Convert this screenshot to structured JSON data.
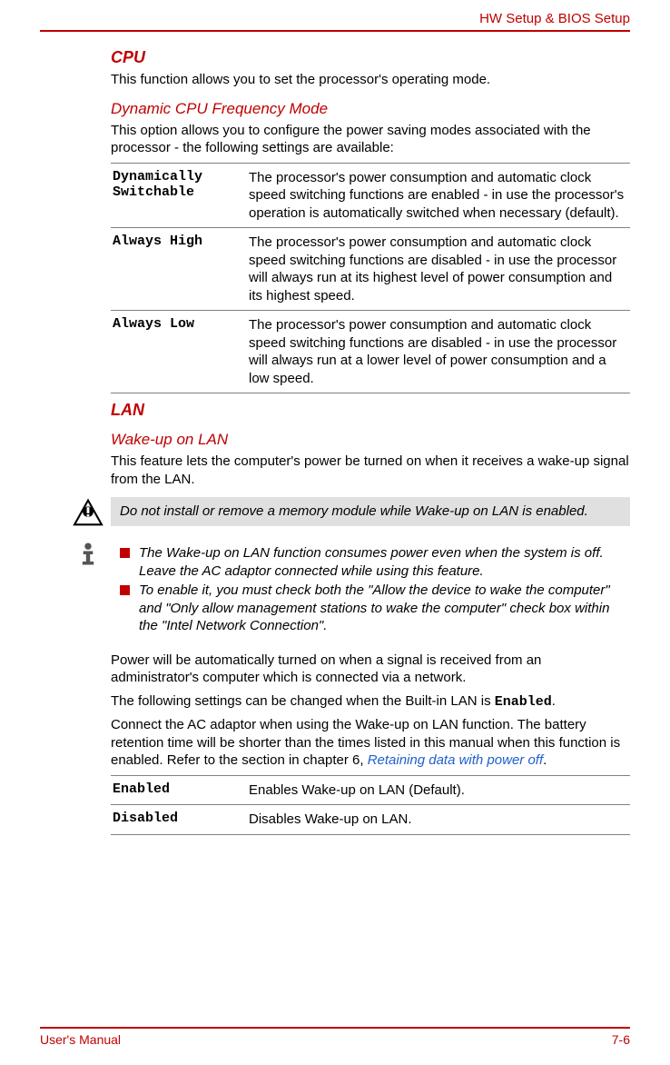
{
  "header": {
    "right": "HW Setup & BIOS Setup"
  },
  "cpu": {
    "heading": "CPU",
    "intro": "This function allows you to set the processor's operating mode.",
    "subheading": "Dynamic CPU Frequency Mode",
    "subintro": "This option allows you to configure the power saving modes associated with the processor - the following settings are available:",
    "rows": [
      {
        "term": "Dynamically Switchable",
        "desc": "The processor's power consumption and automatic clock speed switching functions are enabled - in use the processor's operation is automatically switched when necessary (default)."
      },
      {
        "term": "Always High",
        "desc": "The processor's power consumption and automatic clock speed switching functions are disabled - in use the processor will always run at its highest level of power consumption and its highest speed."
      },
      {
        "term": "Always Low",
        "desc": "The processor's power consumption and automatic clock speed switching functions are disabled - in use the processor will always run at a lower level of power consumption and a low speed."
      }
    ]
  },
  "lan": {
    "heading": "LAN",
    "subheading": "Wake-up on LAN",
    "intro": "This feature lets the computer's power be turned on when it receives a wake-up signal from the LAN.",
    "warning": "Do not install or remove a memory module while Wake-up on LAN is enabled.",
    "info_items": [
      "The Wake-up on LAN function consumes power even when the system is off. Leave the AC adaptor connected while using this feature.",
      "To enable it, you must check both the \"Allow the device to wake the computer\" and \"Only allow management stations to wake the computer\" check box within the \"Intel Network Connection\"."
    ],
    "para1": "Power will be automatically turned on when a signal is received from an administrator's computer which is connected via a network.",
    "para2_pre": "The following settings can be changed when the Built-in LAN is ",
    "para2_mono": "Enabled",
    "para2_post": ".",
    "para3_pre": "Connect the AC adaptor when using the Wake-up on LAN function. The battery retention time will be shorter than the times listed in this manual when this function is enabled. Refer to the section in chapter 6, ",
    "para3_link": "Retaining data with power off",
    "para3_post": ".",
    "rows": [
      {
        "term": "Enabled",
        "desc": "Enables Wake-up on LAN (Default)."
      },
      {
        "term": "Disabled",
        "desc": "Disables Wake-up on LAN."
      }
    ]
  },
  "footer": {
    "left": "User's Manual",
    "right": "7-6"
  }
}
